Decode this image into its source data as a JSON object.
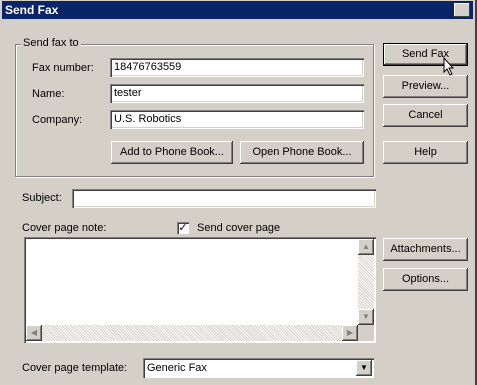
{
  "window": {
    "title": "Send Fax",
    "close_glyph": "✕"
  },
  "send_to": {
    "legend": "Send fax to",
    "fax_number_label": "Fax number:",
    "fax_number_value": "18476763559",
    "name_label": "Name:",
    "name_value": "tester",
    "company_label": "Company:",
    "company_value": "U.S. Robotics",
    "add_phone_book_label": "Add to Phone Book...",
    "open_phone_book_label": "Open Phone Book..."
  },
  "side_buttons": {
    "send_fax": "Send Fax",
    "preview": "Preview...",
    "cancel": "Cancel",
    "help": "Help",
    "attachments": "Attachments...",
    "options": "Options..."
  },
  "subject": {
    "label": "Subject:",
    "value": ""
  },
  "cover": {
    "note_label": "Cover page note:",
    "send_cover_label": "Send cover page",
    "send_cover_checked": true,
    "note_value": "",
    "template_label": "Cover page template:",
    "template_value": "Generic Fax"
  },
  "icons": {
    "check": "✓",
    "up": "▲",
    "down": "▼",
    "left": "◀",
    "right": "▶",
    "combo_arrow": "▼"
  }
}
